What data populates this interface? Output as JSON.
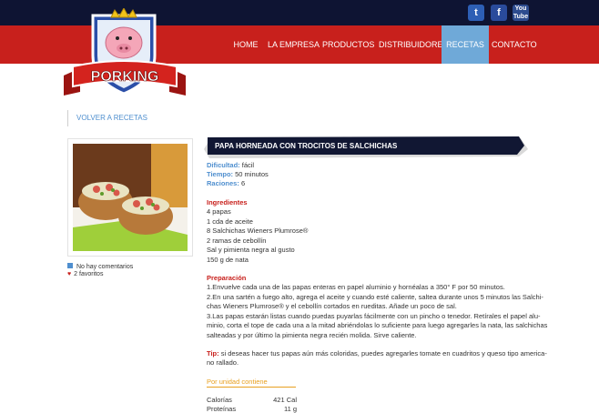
{
  "social": {
    "twitter": "t",
    "facebook": "f",
    "youtube_top": "You",
    "youtube_bottom": "Tube"
  },
  "brand": {
    "logo_text": "PORKING"
  },
  "nav": [
    "HOME",
    "LA EMPRESA",
    "PRODUCTOS",
    "DISTRIBUIDORES",
    "RECETAS",
    "CONTACTO"
  ],
  "back_label": "VOLVER A RECETAS",
  "sidebar": {
    "comments": "No hay comentarios",
    "favorites": "2 favoritos"
  },
  "recipe": {
    "title": "PAPA HORNEADA CON TROCITOS DE SALCHICHAS",
    "difficulty_label": "Dificultad:",
    "difficulty": "fácil",
    "time_label": "Tiempo:",
    "time": "50 minutos",
    "servings_label": "Raciones:",
    "servings": "6",
    "ingredients_title": "Ingredientes",
    "ingredients": [
      "4 papas",
      "1 cda de aceite",
      "8 Salchichas Wieners Plumrose®",
      "2 ramas de cebollín",
      "Sal y pimienta negra al gusto",
      "150 g de nata"
    ],
    "prep_title": "Preparación",
    "prep_lines": [
      "1.Envuelve cada una de las papas enteras en papel aluminio y hornéalas a 350° F por 50 minutos.",
      "2.En una sartén a fuego alto, agrega el aceite y cuando esté caliente, saltea durante unos 5 minutos las Salchi-",
      "chas Wieners Plumrose® y el cebollín cortados en rueditas. Añade un poco de sal.",
      "3.Las papas estarán listas cuando puedas puyarlas fácilmente con un pincho o tenedor. Retírales el papel alu-",
      "minio, corta el tope de cada una a la mitad abriéndolas lo suficiente para luego agregarles la nata, las salchichas",
      "salteadas y por último la pimienta negra recién molida. Sirve caliente."
    ],
    "tip_label": "Tip:",
    "tip_lines": [
      " si deseas hacer tus papas aún más coloridas, puedes agregarles tomate en cuadritos y queso tipo america-",
      "no rallado."
    ],
    "nutrition_title": "Por unidad contiene",
    "nutrition": [
      {
        "name": "Calorías",
        "value": "421 Cal"
      },
      {
        "name": "Proteínas",
        "value": "11 g"
      }
    ]
  },
  "colors": {
    "top_bar": "#0e1433",
    "nav_red": "#c8201c",
    "nav_active": "#6fa9d8",
    "label_blue": "#4f8fcf",
    "accent_orange": "#e8a020"
  }
}
